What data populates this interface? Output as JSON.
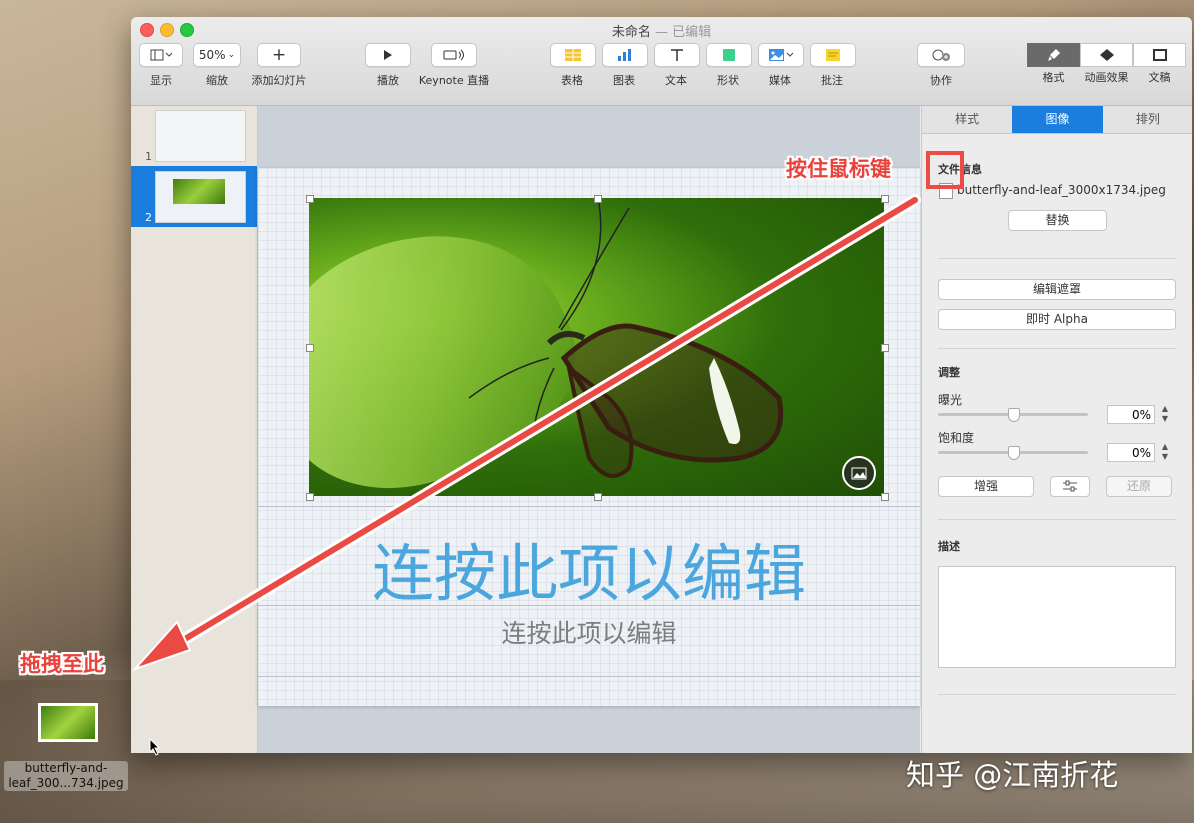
{
  "window": {
    "title": "未命名",
    "title_status": "— 已编辑"
  },
  "toolbar": {
    "view_label": "显示",
    "zoom_value": "50%",
    "zoom_label": "缩放",
    "add_slide_label": "添加幻灯片",
    "play_label": "播放",
    "keynote_live_label": "Keynote 直播",
    "table_label": "表格",
    "chart_label": "图表",
    "text_label": "文本",
    "shape_label": "形状",
    "media_label": "媒体",
    "comment_label": "批注",
    "collaborate_label": "协作",
    "format_label": "格式",
    "animate_label": "动画效果",
    "document_label": "文稿"
  },
  "navigator": {
    "slides": [
      "1",
      "2"
    ],
    "selected": "2"
  },
  "slide": {
    "title": "连按此项以编辑",
    "subtitle": "连按此项以编辑"
  },
  "inspector": {
    "tabs": [
      "样式",
      "图像",
      "排列"
    ],
    "active_tab": "图像",
    "file_info_label": "文件信息",
    "file_name": "butterfly-and-leaf_3000x1734.jpeg",
    "replace_button": "替换",
    "edit_mask_button": "编辑遮罩",
    "instant_alpha_button": "即时 Alpha",
    "adjust_label": "调整",
    "exposure_label": "曝光",
    "exposure_value": "0%",
    "saturation_label": "饱和度",
    "saturation_value": "0%",
    "enhance_button": "增强",
    "revert_button": "还原",
    "description_label": "描述"
  },
  "annotations": {
    "hold_mouse": "按住鼠标键",
    "drag_here": "拖拽至此",
    "color": "#e9423c"
  },
  "desktop": {
    "file_name_line1": "butterfly-and-",
    "file_name_line2": "leaf_300...734.jpeg",
    "credit": "知乎 @江南折花"
  }
}
